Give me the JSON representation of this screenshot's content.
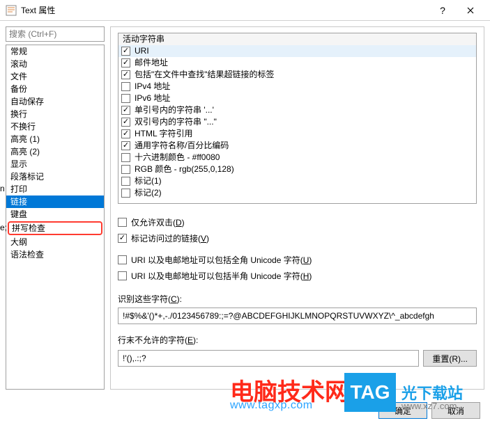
{
  "titlebar": {
    "title": "Text 属性"
  },
  "search": {
    "placeholder": "搜索 (Ctrl+F)"
  },
  "nav": {
    "items": [
      "常规",
      "滚动",
      "文件",
      "备份",
      "自动保存",
      "换行",
      "不换行",
      "高亮 (1)",
      "高亮 (2)",
      "显示",
      "段落标记",
      "打印",
      "链接",
      "键盘",
      "拼写检查",
      "大纲",
      "语法检查"
    ],
    "selected": "链接",
    "highlighted": "拼写检查"
  },
  "checklist": {
    "heading": "活动字符串",
    "items": [
      {
        "label": "URI",
        "checked": true,
        "selected": true
      },
      {
        "label": "邮件地址",
        "checked": true
      },
      {
        "label": "包括\"在文件中查找\"结果超链接的标签",
        "checked": true
      },
      {
        "label": "IPv4 地址",
        "checked": false
      },
      {
        "label": "IPv6 地址",
        "checked": false
      },
      {
        "label": "单引号内的字符串 '...'",
        "checked": true
      },
      {
        "label": "双引号内的字符串 \"...\"",
        "checked": true
      },
      {
        "label": "HTML 字符引用",
        "checked": true
      },
      {
        "label": "通用字符名称/百分比编码",
        "checked": true
      },
      {
        "label": "十六进制颜色 - #ff0080",
        "checked": false
      },
      {
        "label": "RGB 颜色 - rgb(255,0,128)",
        "checked": false
      },
      {
        "label": "标记(1)",
        "checked": false
      },
      {
        "label": "标记(2)",
        "checked": false
      }
    ]
  },
  "opts": {
    "dblclick": {
      "label": "仅允许双击(",
      "accel": "D",
      "suffix": ")",
      "checked": false
    },
    "visited": {
      "label": "标记访问过的链接(",
      "accel": "V",
      "suffix": ")",
      "checked": true
    },
    "fullwidth": {
      "label": "URI 以及电邮地址可以包括全角 Unicode 字符(",
      "accel": "U",
      "suffix": ")",
      "checked": false
    },
    "halfwidth": {
      "label": "URI 以及电邮地址可以包括半角 Unicode 字符(",
      "accel": "H",
      "suffix": ")",
      "checked": false
    }
  },
  "fields": {
    "recognize": {
      "label": "识别这些字符(",
      "accel": "C",
      "suffix": "):",
      "value": "!#$%&'()*+,-./0123456789:;=?@ABCDEFGHIJKLMNOPQRSTUVWXYZ\\^_abcdefgh"
    },
    "disallow": {
      "label": "行末不允许的字符(",
      "accel": "E",
      "suffix": "):",
      "value": "!'(),.:;?"
    }
  },
  "buttons": {
    "reset": "重置(R)...",
    "ok": "确定",
    "cancel": "取消"
  },
  "watermarks": {
    "wm1": "电脑技术网",
    "wm1_sub": "www.tagxp.com",
    "tag": "TAG",
    "wm2": "光下载站",
    "wm2_sub": "www.xz7.com"
  }
}
